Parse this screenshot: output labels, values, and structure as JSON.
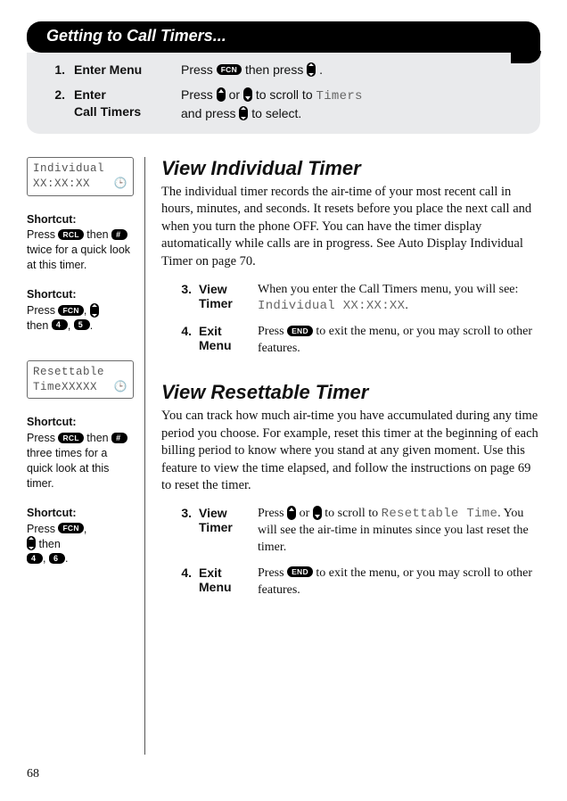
{
  "header": {
    "title": "Getting to Call Timers...",
    "steps": [
      {
        "num": "1.",
        "label": "Enter Menu",
        "body_pre": "Press ",
        "key1": "FCN",
        "body_mid": " then press ",
        "body_post": "."
      },
      {
        "num": "2.",
        "label_line1": "Enter",
        "label_line2": "Call Timers",
        "body_pre": "Press ",
        "body_mid": " or ",
        "body_after_scroll": " to scroll to ",
        "mono_word": "Timers",
        "body_line2_pre": "and press ",
        "body_line2_post": " to select."
      }
    ]
  },
  "sidebar": {
    "phone1": {
      "line1": "Individual",
      "line2": "XX:XX:XX"
    },
    "shortcut1": {
      "title": "Shortcut:",
      "pre": "Press ",
      "key1": "RCL",
      "mid1": " then ",
      "key2": "#",
      "tail": " twice for a quick look at this timer."
    },
    "shortcut2": {
      "title": "Shortcut:",
      "pre": "Press ",
      "key1": "FCN",
      "comma": ", ",
      "line2_pre": "then ",
      "d1": "4",
      "sep": ", ",
      "d2": "5",
      "tail": "."
    },
    "phone2": {
      "line1": "Resettable",
      "line2": "TimeXXXXX"
    },
    "shortcut3": {
      "title": "Shortcut:",
      "pre": "Press ",
      "key1": "RCL",
      "mid1": " then ",
      "key2": "#",
      "tail": " three times for a quick look at this timer."
    },
    "shortcut4": {
      "title": "Shortcut:",
      "pre": "Press ",
      "key1": "FCN",
      "comma": ", ",
      "line2_mid": " then ",
      "d1": "4",
      "sep": ", ",
      "d2": "6",
      "tail": "."
    }
  },
  "section1": {
    "title": "View Individual Timer",
    "para": "The individual timer records the air-time of your most recent call in hours, minutes, and seconds. It resets before you place the next call and when you turn the phone OFF. You can have the timer display automatically while calls are in progress. See Auto Display Individual Timer on page 70.",
    "steps": [
      {
        "num": "3.",
        "label_line1": "View",
        "label_line2": "Timer",
        "body_pre": "When you enter the Call Timers menu, you will see: ",
        "mono": "Individual XX:XX:XX",
        "body_post": "."
      },
      {
        "num": "4.",
        "label_line1": "Exit",
        "label_line2": "Menu",
        "body_pre": "Press ",
        "key1": "END",
        "body_post": " to exit the menu, or you may scroll to other features."
      }
    ]
  },
  "section2": {
    "title": "View Resettable Timer",
    "para": "You can track how much air-time you have accumulated during any time period you choose. For example, reset this timer at the beginning of each billing period to know where you stand at any given moment. Use this feature to view the time elapsed, and follow the instructions on page 69 to reset the timer.",
    "steps": [
      {
        "num": "3.",
        "label_line1": "View",
        "label_line2": "Timer",
        "body_pre": "Press ",
        "body_mid": " or ",
        "body_after_scroll": " to scroll to ",
        "mono": "Resettable Time",
        "body_post": ". You will see the air-time in minutes since you last reset the timer."
      },
      {
        "num": "4.",
        "label_line1": "Exit",
        "label_line2": "Menu",
        "body_pre": "Press ",
        "key1": "END",
        "body_post": " to exit the menu, or you may scroll to other features."
      }
    ]
  },
  "page_number": "68"
}
